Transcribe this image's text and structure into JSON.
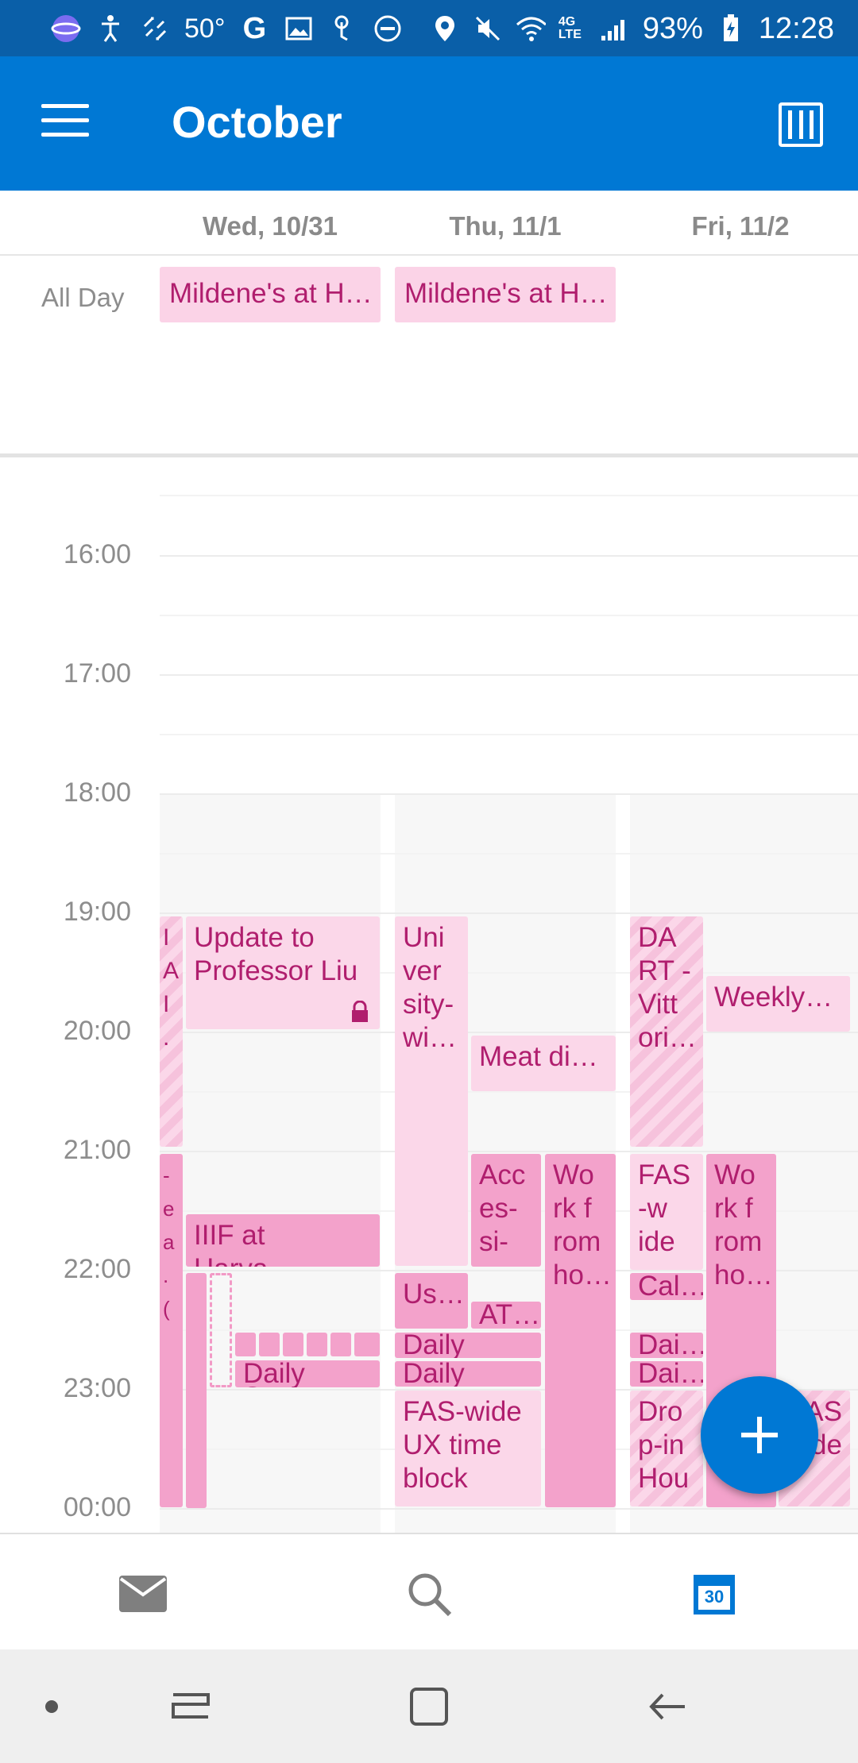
{
  "status_bar": {
    "temperature": "50°",
    "battery": "93%",
    "time": "12:28",
    "network": "4G LTE"
  },
  "app_bar": {
    "title": "October",
    "menu_icon": "hamburger-menu-icon",
    "view_icon": "calendar-view-icon"
  },
  "days": [
    {
      "label": "Wed, 10/31"
    },
    {
      "label": "Thu, 11/1"
    },
    {
      "label": "Fri, 11/2"
    }
  ],
  "all_day": {
    "label": "All Day",
    "events": [
      {
        "title": "Mildene's at H…"
      },
      {
        "title": "Mildene's at H…"
      }
    ]
  },
  "hours": [
    "16:00",
    "17:00",
    "18:00",
    "19:00",
    "20:00",
    "21:00",
    "22:00",
    "23:00",
    "00:00"
  ],
  "events": {
    "wed_a": "I A I .",
    "wed_update": "Update to Professor Liu",
    "wed_b": "- e a . (",
    "wed_iiif": "IIIF at Harva…",
    "wed_daily": "Daily Scr…",
    "thu_univ": "Uni ver sity-wi…",
    "thu_meat": "Meat di…",
    "thu_access": "Acc es- si-",
    "thu_work": "Wo rk f rom ho…",
    "thu_us": "Us…",
    "thu_at": "AT…",
    "thu_daily1": "Daily scr…",
    "thu_daily2": "Daily Scr…",
    "thu_fas": "FAS-wide UX time block",
    "fri_dart": "DA RT - Vitt ori…",
    "fri_weekly": "Weekly…",
    "fri_fas": "FAS -w ide",
    "fri_work": "Wo rk f rom ho…",
    "fri_cal": "Cal…",
    "fri_dai1": "Dai…",
    "fri_dai2": "Dai…",
    "fri_drop": "Dro p-in Hou",
    "fri_fas2": "AS ide"
  },
  "bottom_tabs": {
    "mail": "mail-icon",
    "search": "search-icon",
    "calendar_day": "30"
  },
  "colors": {
    "brand_blue": "#0078d4",
    "event_text": "#b01e6e",
    "event_light": "#fbd7e9",
    "event_dark": "#f3a2cb"
  }
}
